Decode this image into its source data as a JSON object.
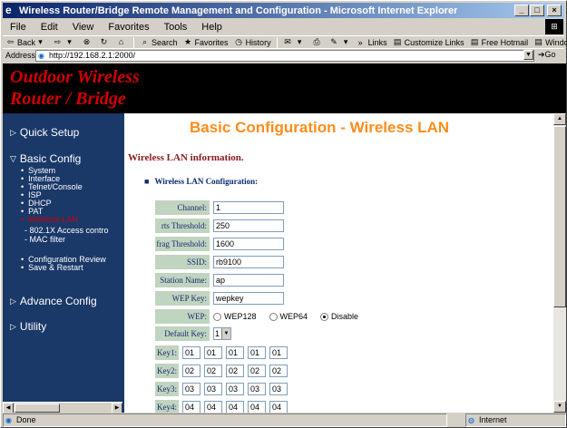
{
  "window": {
    "title": "Wireless Router/Bridge Remote Management and Configuration - Microsoft Internet Explorer",
    "buttons": {
      "minimize": "_",
      "maximize": "□",
      "close": "×"
    }
  },
  "menubar": {
    "items": [
      "File",
      "Edit",
      "View",
      "Favorites",
      "Tools",
      "Help"
    ]
  },
  "toolbar": {
    "back": "Back",
    "search": "Search",
    "favorites": "Favorites",
    "history": "History",
    "links": "Links",
    "link1": "Customize Links",
    "link2": "Free Hotmail",
    "link3": "Windows"
  },
  "addressbar": {
    "label": "Address",
    "url": "http://192.168.2.1:2000/",
    "go": "Go"
  },
  "banner": {
    "line1": "Outdoor Wireless",
    "line2": "Router / Bridge"
  },
  "sidebar": {
    "quick_setup": "Quick Setup",
    "basic_config": "Basic Config",
    "basic_items": [
      "System",
      "Interface",
      "Telnet/Console",
      "ISP",
      "DHCP",
      "PAT",
      "Wireless LAN"
    ],
    "wlan_sub": [
      "- 802.1X Access contro",
      "- MAC filter"
    ],
    "config_items": [
      "Configuration Review",
      "Save & Restart"
    ],
    "advance_config": "Advance Config",
    "utility": "Utility"
  },
  "page": {
    "heading": "Basic Configuration - Wireless LAN",
    "info": "Wireless LAN information.",
    "section": "Wireless LAN Configuration:"
  },
  "form": {
    "channel": {
      "label": "Channel:",
      "value": "1"
    },
    "rts": {
      "label": "rts Threshold:",
      "value": "250"
    },
    "frag": {
      "label": "frag Threshold:",
      "value": "1600"
    },
    "ssid": {
      "label": "SSID:",
      "value": "rb9100"
    },
    "station": {
      "label": "Station Name:",
      "value": "ap"
    },
    "wepkey": {
      "label": "WEP Key:",
      "value": "wepkey"
    },
    "wep": {
      "label": "WEP:",
      "options": [
        "WEP128",
        "WEP64",
        "Disable"
      ],
      "selected": "Disable"
    },
    "default_key": {
      "label": "Default Key:",
      "value": "1"
    },
    "keys": [
      {
        "label": "Key1:",
        "values": [
          "01",
          "01",
          "01",
          "01",
          "01"
        ]
      },
      {
        "label": "Key2:",
        "values": [
          "02",
          "02",
          "02",
          "02",
          "02"
        ]
      },
      {
        "label": "Key3:",
        "values": [
          "03",
          "03",
          "03",
          "03",
          "03"
        ]
      },
      {
        "label": "Key4:",
        "values": [
          "04",
          "04",
          "04",
          "04",
          "04"
        ]
      }
    ]
  },
  "status": {
    "left": "Done",
    "right": "Internet"
  }
}
